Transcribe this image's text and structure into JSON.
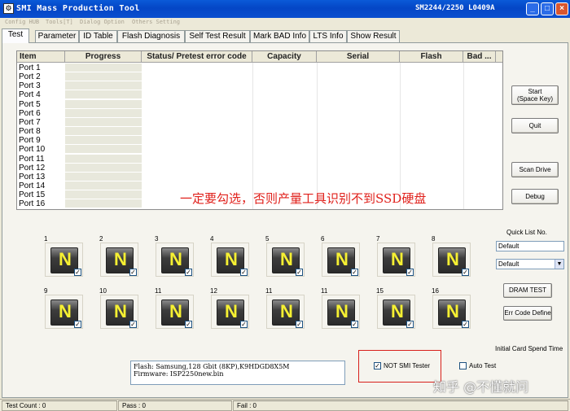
{
  "window": {
    "title": "SMI Mass Production Tool",
    "version": "SM2244/2250    L0409A",
    "minimize": "_",
    "maximize": "□",
    "close": "×"
  },
  "menu": [
    "Config HUB",
    "Tools[T]",
    "Dialog Option",
    "Others Setting"
  ],
  "tabs": [
    "Test",
    "Parameter",
    "ID Table",
    "Flash Diagnosis",
    "Self Test Result",
    "Mark BAD Info",
    "LTS Info",
    "Show Result"
  ],
  "table": {
    "columns": [
      "Item",
      "Progress",
      "Status/ Pretest error code",
      "Capacity",
      "Serial",
      "Flash",
      "Bad ..."
    ],
    "ports": [
      "Port 1",
      "Port 2",
      "Port 3",
      "Port 4",
      "Port 5",
      "Port 6",
      "Port 7",
      "Port 8",
      "Port 9",
      "Port 10",
      "Port 11",
      "Port 12",
      "Port 13",
      "Port 14",
      "Port 15",
      "Port 16"
    ]
  },
  "annotation": "一定要勾选，否则产量工具识别不到SSD硬盘",
  "buttons": {
    "start_line1": "Start",
    "start_line2": "(Space Key)",
    "quit": "Quit",
    "scan_drive": "Scan Drive",
    "debug": "Debug",
    "dram_test": "DRAM TEST",
    "err_code_define": "Err Code Define"
  },
  "slots_row1": [
    "1",
    "2",
    "3",
    "4",
    "5",
    "6",
    "7",
    "8"
  ],
  "slots_row2": [
    "9",
    "10",
    "11",
    "12",
    "11",
    "11",
    "15",
    "16"
  ],
  "slot_letter": "N",
  "check_mark": "✓",
  "quick_list": {
    "label": "Quick List No.",
    "input_value": "Default",
    "select_value": "Default"
  },
  "initial_card_spend_time": "Initial Card Spend Time",
  "info": {
    "flash": "Flash:   Samsung,128 Gbit (8KP),K9HDGD8X5M",
    "firmware": "Firmware:   ISP2250new.bin"
  },
  "checkboxes": {
    "not_smi_tester": "NOT SMI Tester",
    "auto_test": "Auto Test"
  },
  "status": {
    "test_count": "Test Count  :  0",
    "pass": "Pass  :  0",
    "fail": "Fail  :  0"
  },
  "watermark": "知乎 @不懂就问"
}
